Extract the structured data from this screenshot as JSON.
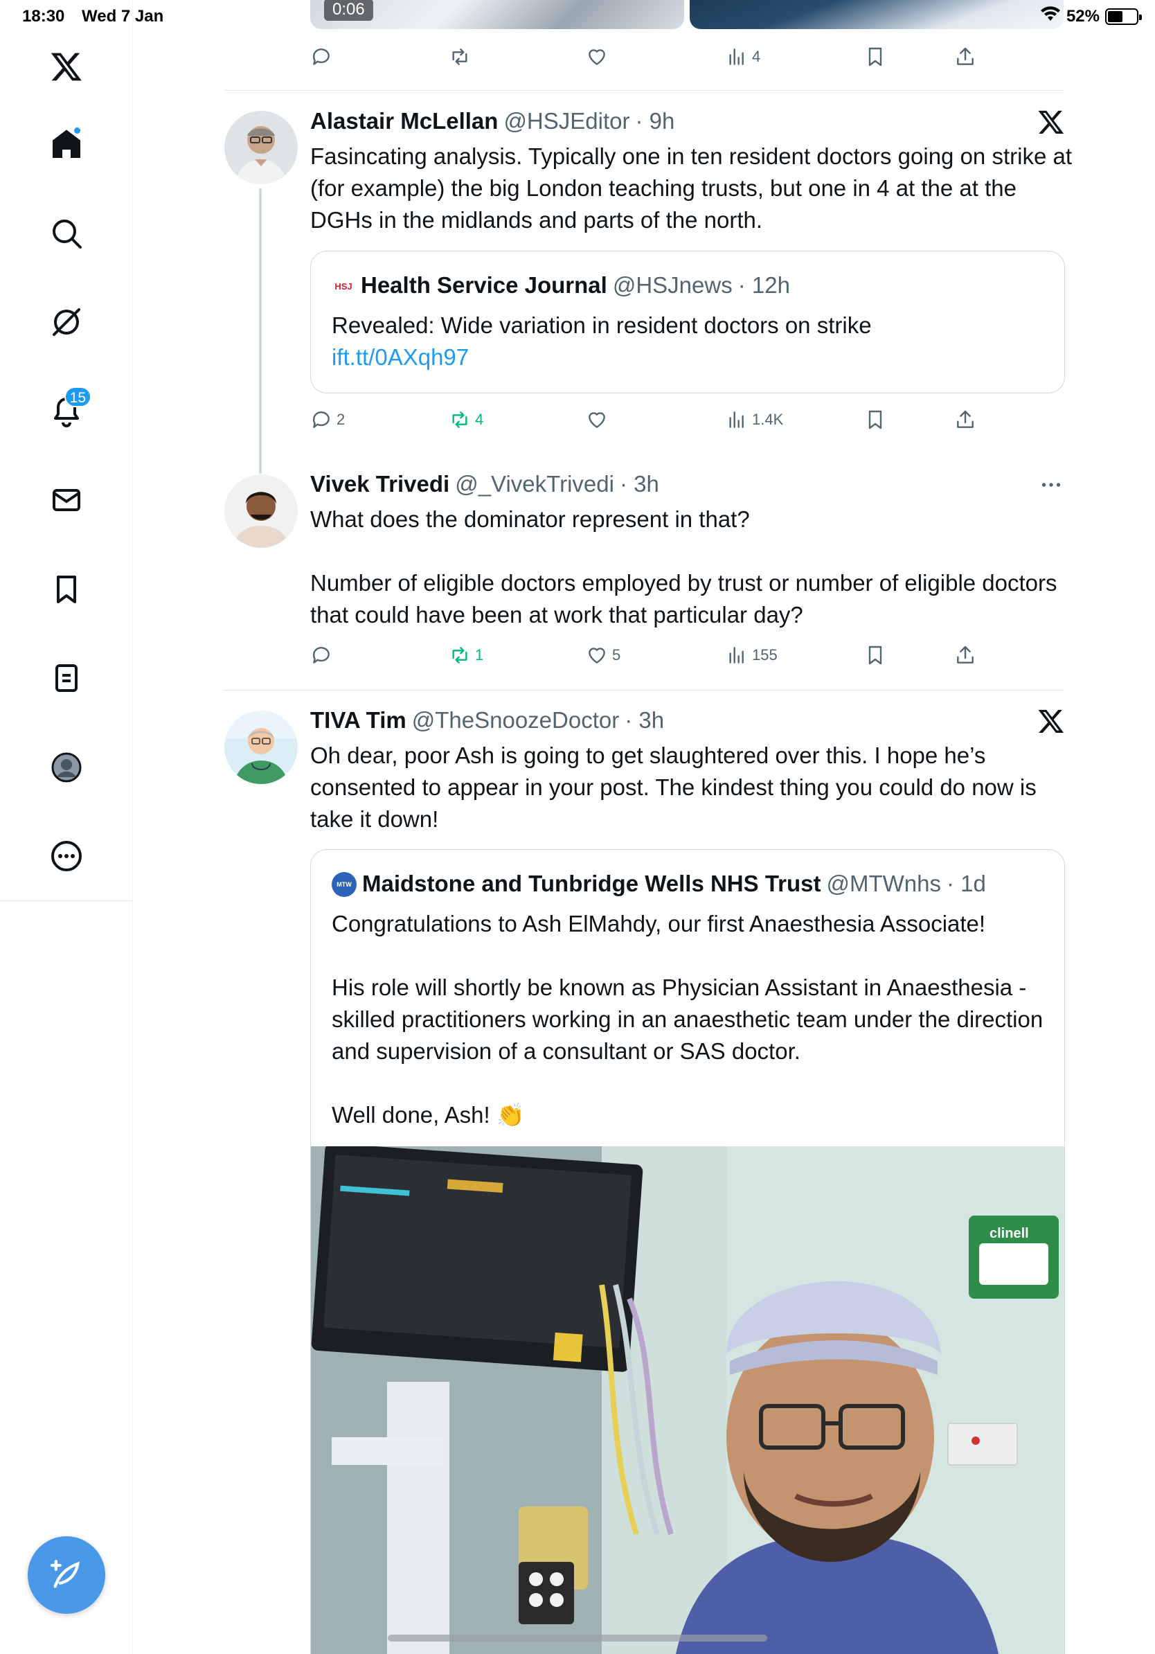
{
  "status_bar": {
    "time": "18:30",
    "date": "Wed 7 Jan",
    "battery": "52%",
    "battery_level": 0.52
  },
  "sidebar": {
    "items": [
      {
        "name": "home",
        "icon": "home-icon",
        "active": true
      },
      {
        "name": "search",
        "icon": "search-icon"
      },
      {
        "name": "grok",
        "icon": "grok-icon"
      },
      {
        "name": "notifications",
        "icon": "bell-icon",
        "badge": "15"
      },
      {
        "name": "messages",
        "icon": "mail-icon"
      },
      {
        "name": "bookmarks",
        "icon": "bookmark-icon"
      },
      {
        "name": "lists",
        "icon": "lists-icon"
      },
      {
        "name": "profile",
        "icon": "profile-icon"
      },
      {
        "name": "more",
        "icon": "more-circle-icon"
      }
    ],
    "compose_icon": "compose-icon"
  },
  "previous_tweet": {
    "media_duration": "0:06",
    "views": "4"
  },
  "tweets": [
    {
      "name": "Alastair McLellan",
      "handle": "@HSJEditor",
      "time": "· 9h",
      "text": "Fasincating analysis. Typically one in ten resident doctors going on strike at (for example) the big London teaching trusts, but one in 4 at the at the DGHs in the midlands and parts of the north.",
      "quote": {
        "name": "Health Service Journal",
        "handle": "@HSJnews",
        "time": "· 12h",
        "logo_text": "HSJ",
        "text": "Revealed: Wide variation in resident doctors on strike ",
        "link": "ift.tt/0AXqh97"
      },
      "replies": "2",
      "reposts": "4",
      "likes": "",
      "views": "1.4K"
    },
    {
      "name": "Vivek Trivedi",
      "handle": "@_VivekTrivedi",
      "time": "· 3h",
      "text": "What does the dominator represent in that?\n\nNumber of eligible doctors employed by trust or number of eligible doctors that could have been at work that particular day?",
      "replies": "",
      "reposts": "1",
      "likes": "5",
      "views": "155"
    },
    {
      "name": "TIVA Tim",
      "handle": "@TheSnoozeDoctor",
      "time": "· 3h",
      "text": "Oh dear, poor Ash is going to get slaughtered over this. I hope he’s consented to appear in your post. The kindest thing you could do now is take it down!",
      "quote": {
        "name": "Maidstone and Tunbridge Wells NHS Trust",
        "handle": "@MTWnhs",
        "time": "· 1d",
        "logo_text": "MTW",
        "text": "Congratulations to Ash ElMahdy, our first Anaesthesia Associate!\n\nHis role will shortly be known as Physician Assistant in Anaesthesia - skilled practitioners working in an anaesthetic team under the direction and supervision of a consultant or SAS doctor.\n\nWell done, Ash! 👏",
        "photo_label": "clinell"
      }
    }
  ],
  "colors": {
    "accent": "#1d9bf0",
    "repost_green": "#00ba7c",
    "muted": "#536471",
    "compose": "#4a99e9"
  }
}
